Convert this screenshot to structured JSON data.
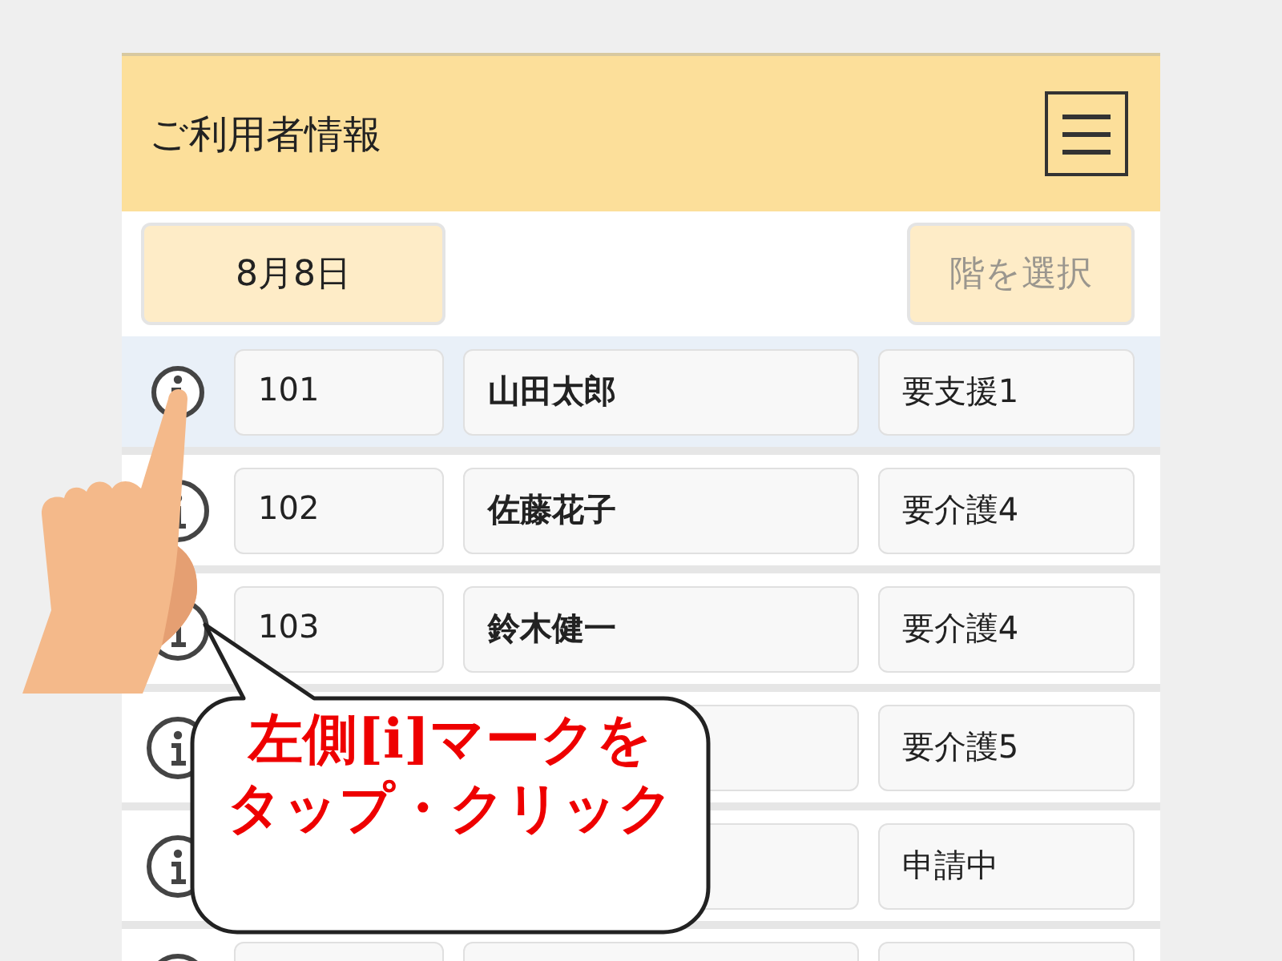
{
  "header": {
    "title": "ご利用者情報"
  },
  "toolbar": {
    "date": "8月8日",
    "floor_button": {
      "label": "階を選択",
      "disabled": true
    }
  },
  "rows": [
    {
      "room": "101",
      "name": "山田太郎",
      "care": "要支援1",
      "selected": true
    },
    {
      "room": "102",
      "name": "佐藤花子",
      "care": "要介護4",
      "selected": false
    },
    {
      "room": "103",
      "name": "鈴木健一",
      "care": "要介護4",
      "selected": false
    },
    {
      "care": "要介護5",
      "selected": false
    },
    {
      "care": "申請中",
      "selected": false
    },
    {
      "selected": false
    }
  ],
  "callout": {
    "lines": [
      "左側[i]マークを",
      "タップ・クリック"
    ]
  }
}
